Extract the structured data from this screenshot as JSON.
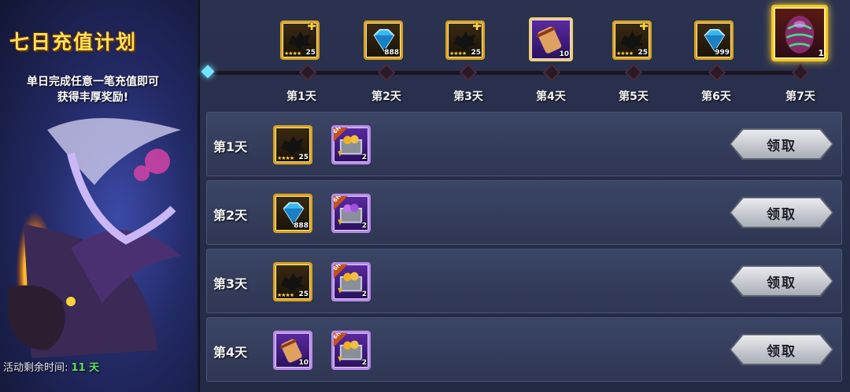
{
  "left": {
    "title": "七日充值计划",
    "subtitle_line1": "单日完成任意一笔充值即可",
    "subtitle_line2": "获得丰厚奖励!",
    "remaining_label": "活动剩余时间:",
    "remaining_value": "11 天"
  },
  "milestones": [
    {
      "day": "第1天",
      "icon": "dragon-soul-icon",
      "qty": "25"
    },
    {
      "day": "第2天",
      "icon": "blue-diamond-icon",
      "qty": "888"
    },
    {
      "day": "第3天",
      "icon": "dragon-soul-icon",
      "qty": "25"
    },
    {
      "day": "第4天",
      "icon": "scroll-icon",
      "qty": "10"
    },
    {
      "day": "第5天",
      "icon": "dragon-soul-icon",
      "qty": "25"
    },
    {
      "day": "第6天",
      "icon": "blue-diamond-icon",
      "qty": "999"
    },
    {
      "day": "第7天",
      "icon": "dragon-egg-icon",
      "qty": "1"
    }
  ],
  "rows": [
    {
      "label": "第1天",
      "reward1_qty": "25",
      "reward1_icon": "dragon-soul-icon",
      "reward2_qty": "2",
      "reward2_icon": "gold-chest-icon",
      "reward2_tag": "6H",
      "button": "领取"
    },
    {
      "label": "第2天",
      "reward1_qty": "888",
      "reward1_icon": "blue-diamond-icon",
      "reward2_qty": "2",
      "reward2_icon": "purple-chest-icon",
      "reward2_tag": "6H",
      "button": "领取"
    },
    {
      "label": "第3天",
      "reward1_qty": "25",
      "reward1_icon": "dragon-soul-icon",
      "reward2_qty": "2",
      "reward2_icon": "gold-chest-icon",
      "reward2_tag": "6H",
      "button": "领取"
    },
    {
      "label": "第4天",
      "reward1_qty": "10",
      "reward1_icon": "scroll-icon",
      "reward2_qty": "2",
      "reward2_icon": "gold-chest-icon",
      "reward2_tag": "6H",
      "button": "领取"
    }
  ],
  "stars_text": "★★★★",
  "plus_text": "✚"
}
